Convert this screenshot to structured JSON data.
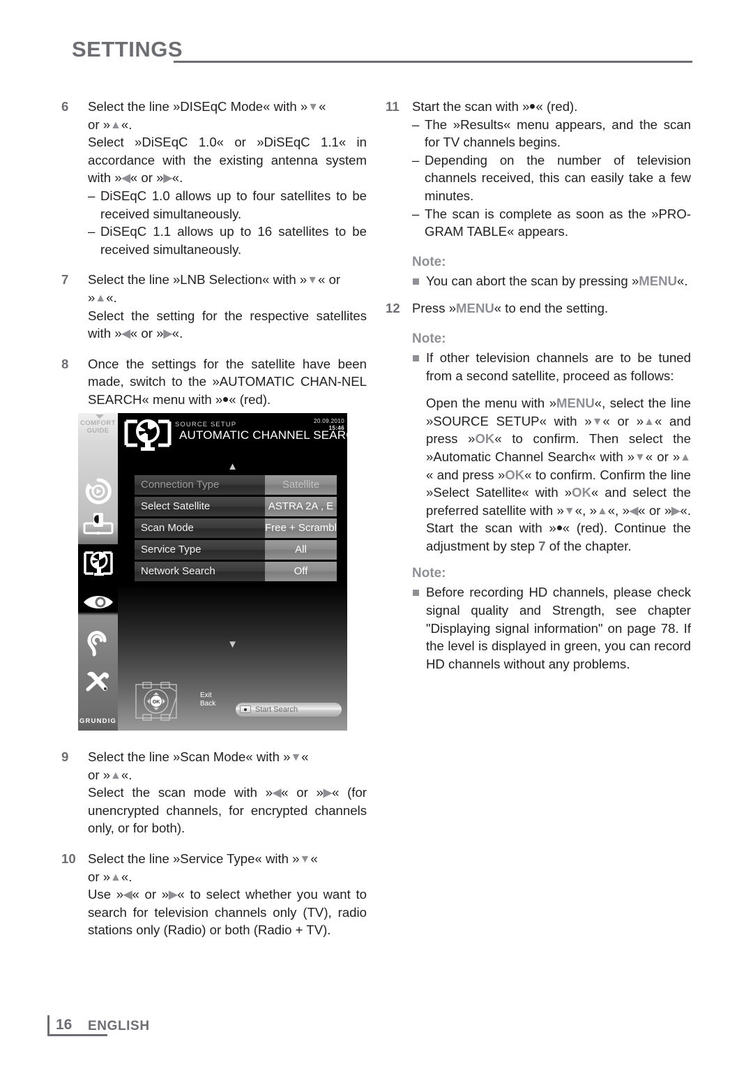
{
  "header": {
    "title": "SETTINGS"
  },
  "footer": {
    "page_number": "16",
    "language": "ENGLISH"
  },
  "colors": {
    "accent_gray": "#6d6e74",
    "note_gray": "#8e9095",
    "body_text": "#231f20"
  },
  "left_column": {
    "step6": {
      "num": "6",
      "line1_a": "Select  the  line  »DISEqC  Mode«  with  »",
      "line1_b": "«",
      "line2_a": "or »",
      "line2_b": "«.",
      "para2_a": "Select  »DiSEqC  1.0«  or  »DiSEqC  1.1«  in accordance with the existing antenna system with »",
      "para2_b": "« or »",
      "para2_c": "«.",
      "bullets": [
        "DiSEqC 1.0 allows up to four satellites to be received simultaneously.",
        "DiSEqC 1.1 allows up to 16 satellites to be received simultaneously."
      ]
    },
    "step7": {
      "num": "7",
      "line1_a": "Select the line »LNB Selection« with »",
      "line1_b": "« or",
      "line2_a": "»",
      "line2_b": "«.",
      "para2_a": "Select the setting for the respective satellites with »",
      "para2_b": "« or »",
      "para2_c": "«."
    },
    "step8": {
      "num": "8",
      "text_a": "Once the settings for the satellite have been made,  switch  to  the  »AUTOMATIC  CHAN-NEL SEARCH« menu with »",
      "text_b": "« (red)."
    },
    "step9": {
      "num": "9",
      "line1_a": "Select  the  line  »Scan  Mode«  with  »",
      "line1_b": "«",
      "line2_a": "or »",
      "line2_b": "«.",
      "para2_a": "Select  the  scan  mode  with  »",
      "para2_b": "«  or  »",
      "para2_c": "« (for  unencrypted  channels,  for  encrypted channels only, or for both)."
    },
    "step10": {
      "num": "10",
      "line1_a": "Select  the  line  »Service  Type«  with  »",
      "line1_b": "«",
      "line2_a": "or »",
      "line2_b": "«.",
      "para2_a": "Use  »",
      "para2_b": "«  or  »",
      "para2_c": "«  to  select  whether  you want to search for television channels only (TV),  radio  stations  only  (Radio)  or  both (Radio + TV)."
    }
  },
  "right_column": {
    "step11": {
      "num": "11",
      "text_a": "Start the scan with »",
      "text_b": "« (red).",
      "bullets": [
        "The »Results« menu appears, and the scan for TV channels begins.",
        "Depending  on  the  number  of  television channels  received,  this  can  easily  take  a few minutes.",
        "The scan is complete as soon as the »PRO-GRAM TABLE« appears."
      ]
    },
    "note1": {
      "title": "Note:",
      "item_a": "You   can   abort   the   scan   by   pressing »",
      "item_key": "MENU",
      "item_b": "«."
    },
    "step12": {
      "num": "12",
      "text_a": "Press »",
      "text_key": "MENU",
      "text_b": "« to end the setting."
    },
    "note2": {
      "title": "Note:",
      "item": "If other television channels are to be tuned from a second satellite, proceed as follows:",
      "para_1": "Open  the  menu  with  »",
      "para_key1": "MENU",
      "para_2": "«,  select  the line  »SOURCE  SETUP«  with  »",
      "para_3": "«  or  »",
      "para_4": "« and press »",
      "para_key2": "OK",
      "para_5": "« to confirm. Then select the »Automatic  Channel  Search«  with  »",
      "para_6": "«  or »",
      "para_7": "«  and  press  »",
      "para_key3": "OK",
      "para_8": "«  to  confirm.  Confirm the  line  »Select  Satellite«  with  »",
      "para_key4": "OK",
      "para_9": "«  and select the preferred satellite with »",
      "para_10": "«, »",
      "para_11": "«, »",
      "para_12": "« or »",
      "para_13": "«. Start  the  scan  with  »",
      "para_14": "« (red). Continue  the  adjustment  by  step  ",
      "para_stepref": "7",
      "para_15": "  of  the chapter."
    },
    "note3": {
      "title": "Note:",
      "item": "Before  recording  HD  channels,  please check  signal  quality  and  Strength,  see chapter \"Displaying signal information\" on page 78. If the level is displayed in green, you  can  record  HD  channels  without  any problems."
    }
  },
  "tv_screenshot": {
    "rail": {
      "comfort_guide_line1": "COMFORT",
      "comfort_guide_line2": "GUIDE",
      "brand": "GRUNDIG",
      "icons": [
        "media-playback-icon",
        "external-sources-icon",
        "satellite-source-setup-icon",
        "eye-picture-settings-icon",
        "ear-sound-settings-icon",
        "tools-special-functions-icon"
      ]
    },
    "breadcrumb": "SOURCE SETUP",
    "title": "AUTOMATIC CHANNEL SEARCH",
    "date": "20.09.2010",
    "time": "15:46",
    "rows": [
      {
        "label": "Connection Type",
        "value": "Satellite",
        "dim": true
      },
      {
        "label": "Select Satellite",
        "value": "ASTRA 2A , E",
        "dim": false
      },
      {
        "label": "Scan Mode",
        "value": "Free + Scramble",
        "dim": false
      },
      {
        "label": "Service Type",
        "value": "All",
        "dim": false
      },
      {
        "label": "Network Search",
        "value": "Off",
        "dim": false
      }
    ],
    "dpad_ok": "OK",
    "hint_exit": "Exit",
    "hint_back": "Back",
    "start_search": "Start Search"
  }
}
